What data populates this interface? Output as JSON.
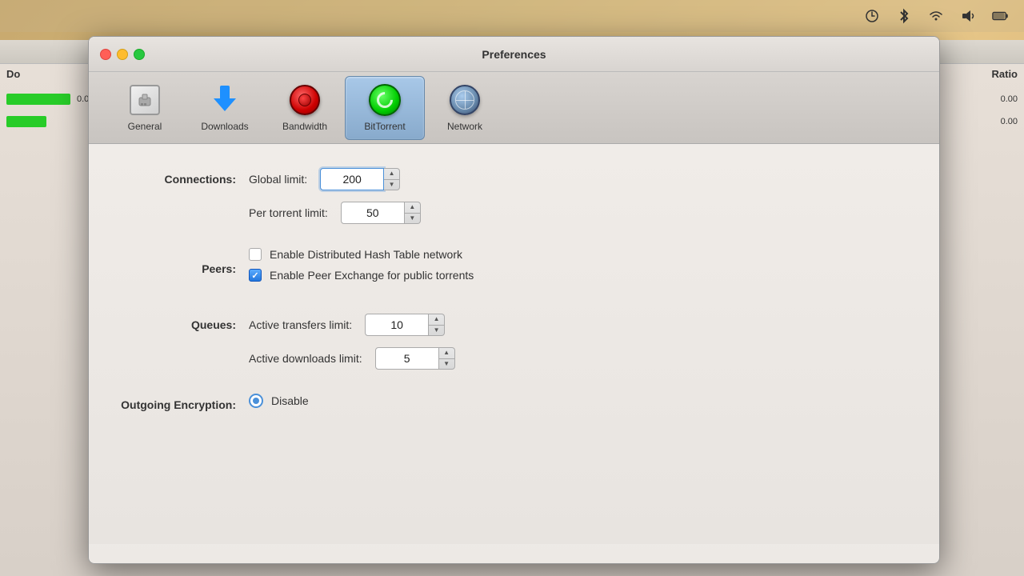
{
  "window": {
    "title": "Preferences"
  },
  "window_controls": {
    "close_label": "close",
    "minimize_label": "minimize",
    "maximize_label": "maximize"
  },
  "toolbar": {
    "items": [
      {
        "id": "general",
        "label": "General",
        "icon": "general-icon",
        "active": false
      },
      {
        "id": "downloads",
        "label": "Downloads",
        "icon": "downloads-icon",
        "active": false
      },
      {
        "id": "bandwidth",
        "label": "Bandwidth",
        "icon": "bandwidth-icon",
        "active": false
      },
      {
        "id": "bittorrent",
        "label": "BitTorrent",
        "icon": "bittorrent-icon",
        "active": true
      },
      {
        "id": "network",
        "label": "Network",
        "icon": "network-icon",
        "active": false
      }
    ]
  },
  "connections": {
    "section_label": "Connections:",
    "global_limit_label": "Global limit:",
    "global_limit_value": "200",
    "per_torrent_label": "Per torrent limit:",
    "per_torrent_value": "50"
  },
  "peers": {
    "section_label": "Peers:",
    "dht_label": "Enable Distributed Hash Table network",
    "dht_checked": false,
    "pex_label": "Enable Peer Exchange for public torrents",
    "pex_checked": true
  },
  "queues": {
    "section_label": "Queues:",
    "active_transfers_label": "Active transfers limit:",
    "active_transfers_value": "10",
    "active_downloads_label": "Active downloads limit:",
    "active_downloads_value": "5"
  },
  "outgoing_encryption": {
    "section_label": "Outgoing Encryption:",
    "disable_label": "Disable",
    "disable_selected": true
  },
  "background": {
    "col_do": "Do",
    "col_ratio": "Ratio",
    "row1_ratio": "0.00",
    "row2_ratio": "0.00"
  },
  "macos_icons": {
    "time_machine": "🕐",
    "bluetooth": "✱",
    "wifi": "📶",
    "audio": "🔊",
    "battery": "🔋"
  }
}
